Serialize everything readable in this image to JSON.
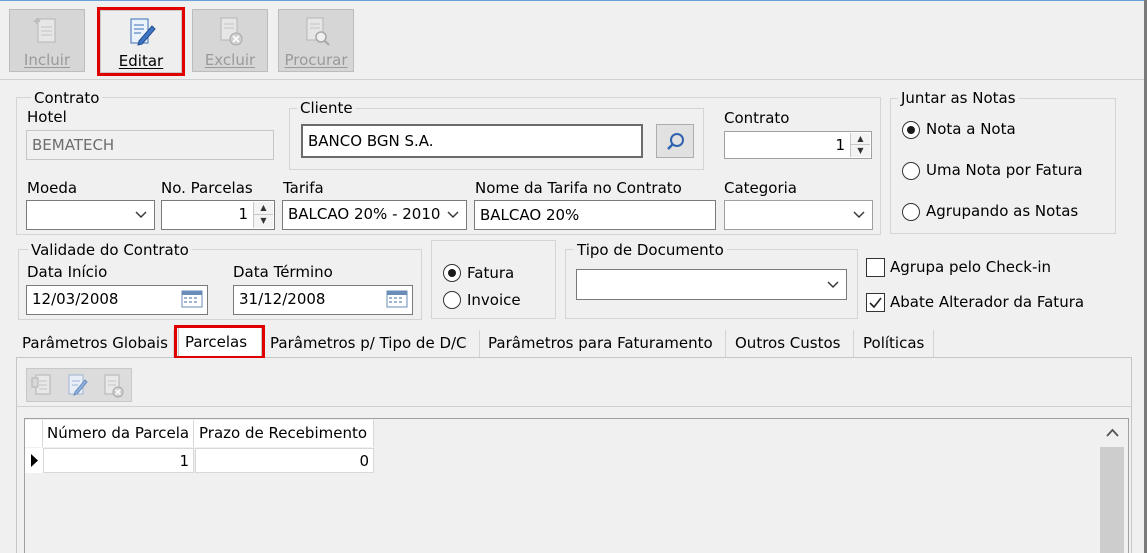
{
  "toolbar": {
    "incluir": "Incluir",
    "editar": "Editar",
    "excluir": "Excluir",
    "procurar": "Procurar"
  },
  "contrato_group": {
    "legend": "Contrato",
    "hotel_label": "Hotel",
    "hotel_value": "BEMATECH",
    "cliente_legend": "Cliente",
    "cliente_value": "BANCO BGN S.A.",
    "contrato_label": "Contrato",
    "contrato_value": "1",
    "moeda_label": "Moeda",
    "moeda_value": "",
    "parcelas_label": "No. Parcelas",
    "parcelas_value": "1",
    "tarifa_label": "Tarifa",
    "tarifa_value": "BALCAO 20% - 2010",
    "nome_tarifa_label": "Nome da Tarifa no Contrato",
    "nome_tarifa_value": "BALCAO 20%",
    "categoria_label": "Categoria",
    "categoria_value": ""
  },
  "juntar": {
    "legend": "Juntar as Notas",
    "options": [
      "Nota a Nota",
      "Uma Nota por Fatura",
      "Agrupando as Notas"
    ],
    "selected": "Nota a Nota"
  },
  "validade": {
    "legend": "Validade do Contrato",
    "inicio_label": "Data Início",
    "inicio_value": "12/03/2008",
    "termino_label": "Data Término",
    "termino_value": "31/12/2008"
  },
  "doc_type": {
    "fatura": "Fatura",
    "invoice": "Invoice",
    "selected": "Fatura",
    "tipo_legend": "Tipo de Documento",
    "tipo_value": ""
  },
  "checks": {
    "agrupa": "Agrupa pelo Check-in",
    "agrupa_checked": false,
    "abate": "Abate Alterador da Fatura",
    "abate_checked": true
  },
  "tabs": [
    "Parâmetros Globais",
    "Parcelas",
    "Parâmetros p/ Tipo de D/C",
    "Parâmetros para Faturamento",
    "Outros Custos",
    "Políticas"
  ],
  "selected_tab": "Parcelas",
  "grid": {
    "columns": [
      "Número da Parcela",
      "Prazo de Recebimento"
    ],
    "rows": [
      {
        "parcela": "1",
        "prazo": "0"
      }
    ]
  },
  "colors": {
    "highlight": "#e00000",
    "accent": "#2f63b0"
  }
}
